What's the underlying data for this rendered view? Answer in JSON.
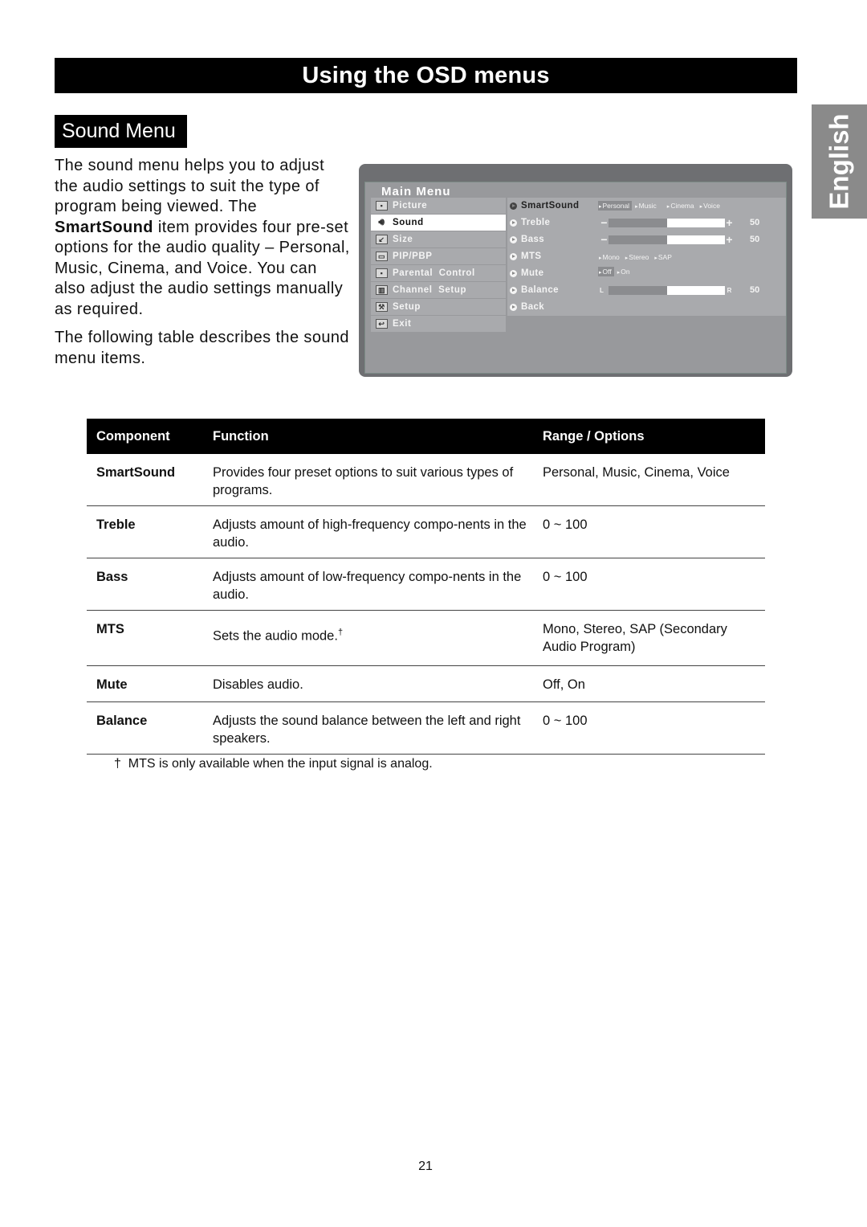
{
  "header": {
    "title": "Using the OSD menus"
  },
  "section": {
    "title": "Sound Menu"
  },
  "language_tab": "English",
  "intro": {
    "p1_before": "The sound menu helps you to adjust the audio settings to suit the type of program being viewed. The ",
    "p1_bold": "SmartSound",
    "p1_after": " item provides four pre-set options for the audio quality – Personal, Music, Cinema, and Voice. You can also adjust the audio settings manually as required.",
    "p2": "The following table describes the sound menu items."
  },
  "osd": {
    "heading": "Main Menu",
    "left_menu": [
      {
        "label": "Picture",
        "icon": "picture-icon",
        "active": false
      },
      {
        "label": "Sound",
        "icon": "speaker-icon",
        "active": true
      },
      {
        "label": "Size",
        "icon": "size-icon",
        "active": false
      },
      {
        "label": "PIP/PBP",
        "icon": "pip-icon",
        "active": false
      },
      {
        "label": "Parental  Control",
        "icon": "parental-lock-icon",
        "active": false
      },
      {
        "label": "Channel  Setup",
        "icon": "tv-icon",
        "active": false
      },
      {
        "label": "Setup",
        "icon": "setup-wrench-icon",
        "active": false
      },
      {
        "label": "Exit",
        "icon": "exit-return-icon",
        "active": false
      }
    ],
    "right_items": [
      {
        "label": "SmartSound",
        "selected": true
      },
      {
        "label": "Treble"
      },
      {
        "label": "Bass"
      },
      {
        "label": "MTS"
      },
      {
        "label": "Mute"
      },
      {
        "label": "Balance"
      },
      {
        "label": "Back"
      }
    ],
    "smartsound_options": [
      "Personal",
      "Music",
      "Cinema",
      "Voice"
    ],
    "smartsound_selected": "Personal",
    "treble": {
      "minus": "−",
      "plus": "+",
      "value": "50",
      "level_pct": 50
    },
    "bass": {
      "minus": "−",
      "plus": "+",
      "value": "50",
      "level_pct": 50
    },
    "mts_options": [
      "Mono",
      "Stereo",
      "SAP"
    ],
    "mute_options": [
      "Off",
      "On"
    ],
    "mute_selected": "Off",
    "balance": {
      "left": "L",
      "right": "R",
      "value": "50",
      "level_pct": 50
    }
  },
  "table": {
    "headers": [
      "Component",
      "Function",
      "Range / Options"
    ],
    "rows": [
      {
        "component": "SmartSound",
        "function": "Provides four preset options to suit various types of programs.",
        "range": "Personal, Music, Cinema, Voice"
      },
      {
        "component": "Treble",
        "function": "Adjusts amount of high-frequency compo-nents in the audio.",
        "range": "0 ~ 100"
      },
      {
        "component": "Bass",
        "function": "Adjusts amount of low-frequency compo-nents in the audio.",
        "range": "0 ~ 100"
      },
      {
        "component": "MTS",
        "function": "Sets the audio mode.",
        "function_sup": "†",
        "range": "Mono, Stereo, SAP (Secondary Audio Program)"
      },
      {
        "component": "Mute",
        "function": "Disables audio.",
        "range": "Off, On"
      },
      {
        "component": "Balance",
        "function": "Adjusts the sound balance between the left and right speakers.",
        "range": "0 ~ 100"
      }
    ]
  },
  "footnote": "†  MTS is only available when the input signal is analog.",
  "page_number": "21"
}
